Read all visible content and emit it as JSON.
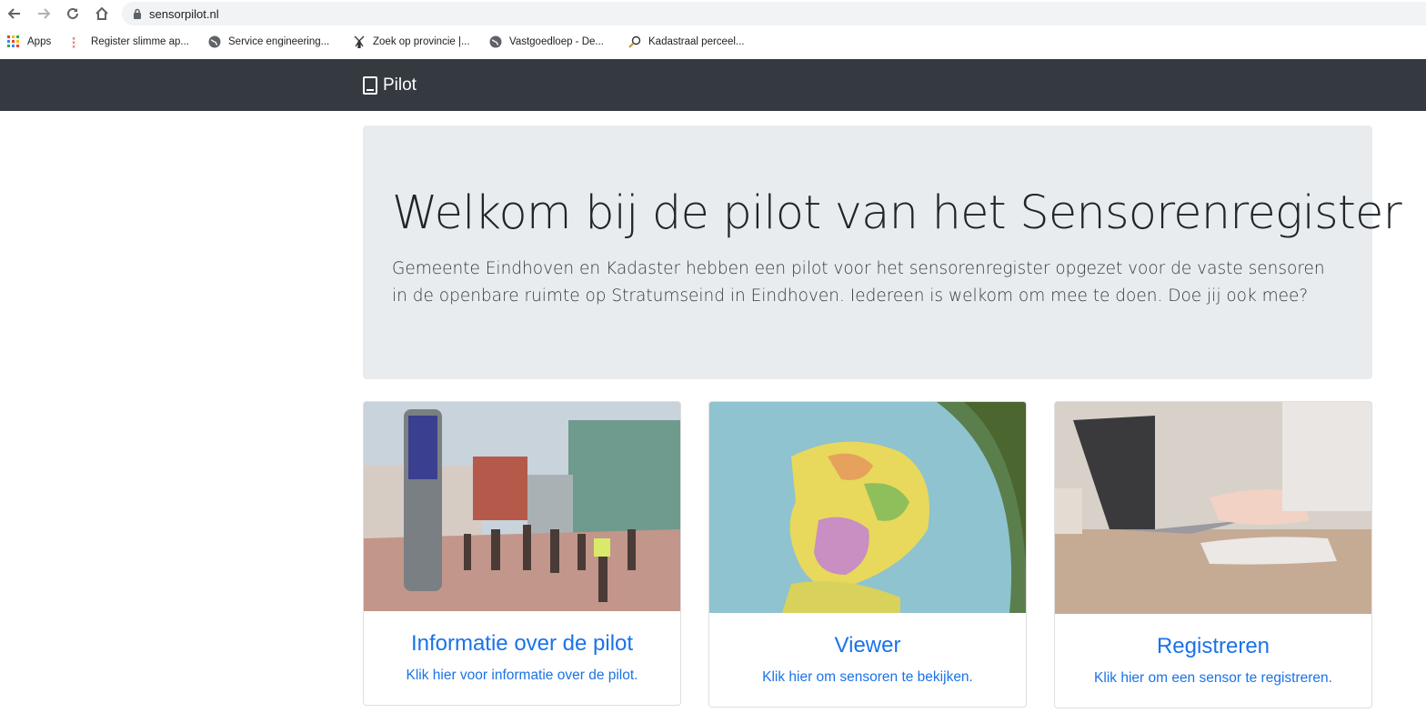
{
  "browser": {
    "url": "sensorpilot.nl",
    "bookmarks": [
      {
        "label": "Apps",
        "icon": "apps-grid-icon"
      },
      {
        "label": "Register slimme ap...",
        "icon": "xxx-flag-icon"
      },
      {
        "label": "Service engineering...",
        "icon": "globe-icon"
      },
      {
        "label": "Zoek op provincie |...",
        "icon": "windmill-icon"
      },
      {
        "label": "Vastgoedloep - De...",
        "icon": "globe-icon"
      },
      {
        "label": "Kadastraal perceel...",
        "icon": "magnifier-icon"
      }
    ]
  },
  "navbar": {
    "brand": "Pilot",
    "brand_icon": "tablet-icon",
    "color": "#343a40"
  },
  "jumbotron": {
    "title": "Welkom bij de pilot van het Sensorenregister",
    "lead": "Gemeente Eindhoven en Kadaster hebben een pilot voor het sensorenregister opgezet voor de vaste sensoren in de openbare ruimte op Stratumseind in Eindhoven. Iedereen is welkom om mee te doen. Doe jij ook mee?"
  },
  "cards": [
    {
      "title": "Informatie over de pilot",
      "text": "Klik hier voor informatie over de pilot."
    },
    {
      "title": "Viewer",
      "text": "Klik hier om sensoren te bekijken."
    },
    {
      "title": "Registreren",
      "text": "Klik hier om een sensor te registreren."
    }
  ],
  "colors": {
    "link": "#1a73e8",
    "jumbo_bg": "#e9ecef"
  }
}
